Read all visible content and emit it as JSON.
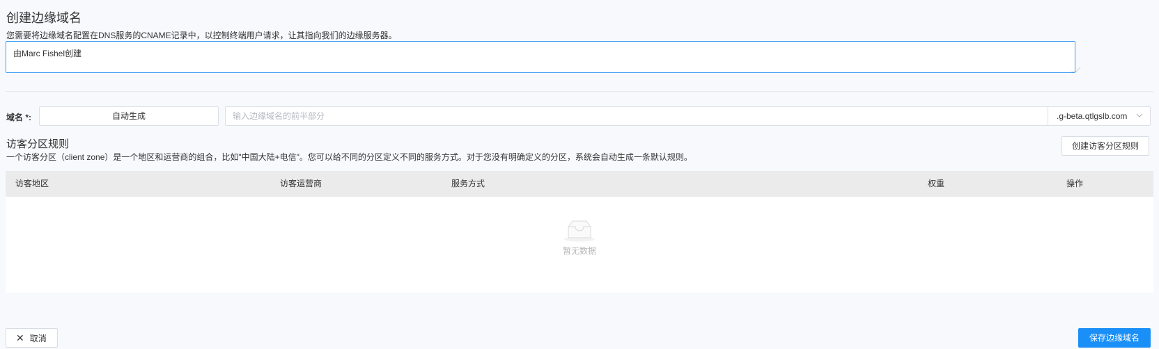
{
  "header": {
    "title": "创建边缘域名",
    "description": "您需要将边缘域名配置在DNS服务的CNAME记录中，以控制终端用户请求，让其指向我们的边缘服务器。"
  },
  "note": {
    "value": "由Marc Fishel创建"
  },
  "domain": {
    "label": "域名 *:",
    "auto_button": "自动生成",
    "prefix_placeholder": "输入边缘域名的前半部分",
    "suffix_value": ".g-beta.qtlgslb.com"
  },
  "zone_rules": {
    "title": "访客分区规则",
    "description": "一个访客分区（client zone）是一个地区和运营商的组合，比如\"中国大陆+电信\"。您可以给不同的分区定义不同的服务方式。对于您没有明确定义的分区，系统会自动生成一条默认规则。",
    "create_button": "创建访客分区规则",
    "columns": [
      "访客地区",
      "访客运营商",
      "服务方式",
      "权重",
      "操作"
    ],
    "empty_text": "暂无数据"
  },
  "footer": {
    "cancel_label": "取消",
    "save_label": "保存边缘域名"
  },
  "colors": {
    "primary": "#1a8ff7",
    "focus_border": "#3b9cf6",
    "background": "#f7f9fc",
    "table_header": "#ebebeb"
  },
  "icons": {
    "close": "close-icon",
    "chevron": "chevron-down-icon",
    "empty": "empty-box-icon"
  }
}
